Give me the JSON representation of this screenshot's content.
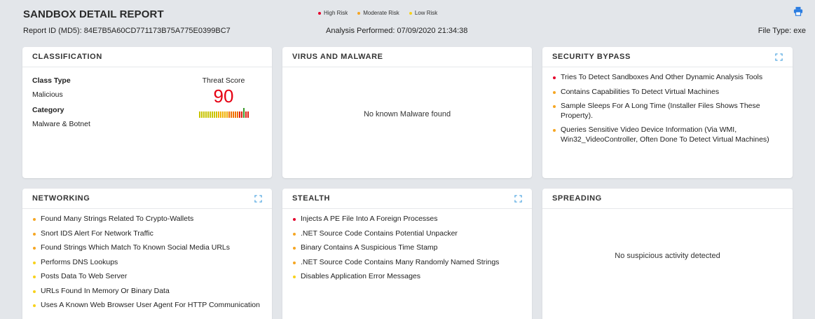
{
  "header": {
    "title": "SANDBOX DETAIL REPORT",
    "report_id": "Report ID (MD5): 84E7B5A60CD771173B75A775E0399BC7",
    "analysis": "Analysis Performed: 07/09/2020 21:34:38",
    "file_type": "File Type: exe"
  },
  "legend": [
    {
      "label": "High Risk",
      "color": "#e4002b"
    },
    {
      "label": "Moderate Risk",
      "color": "#f5a623"
    },
    {
      "label": "Low Risk",
      "color": "#f8d21c"
    }
  ],
  "icons": {
    "print": "print-icon",
    "expand": "expand-icon"
  },
  "colors": {
    "accent": "#2b7de1",
    "threat": "#e60012"
  },
  "classification": {
    "title": "CLASSIFICATION",
    "class_type_label": "Class Type",
    "class_type_value": "Malicious",
    "category_label": "Category",
    "category_value": "Malware & Botnet",
    "threat_label": "Threat Score",
    "threat_score": "90",
    "threat_level": 0.9
  },
  "virus": {
    "title": "VIRUS AND MALWARE",
    "message": "No known Malware found"
  },
  "security_bypass": {
    "title": "SECURITY BYPASS",
    "items": [
      {
        "text": "Tries To Detect Sandboxes And Other Dynamic Analysis Tools",
        "risk": "high"
      },
      {
        "text": "Contains Capabilities To Detect Virtual Machines",
        "risk": "moderate"
      },
      {
        "text": "Sample Sleeps For A Long Time (Installer Files Shows These Property).",
        "risk": "moderate"
      },
      {
        "text": "Queries Sensitive Video Device Information (Via WMI, Win32_VideoController, Often Done To Detect Virtual Machines)",
        "risk": "moderate"
      }
    ]
  },
  "networking": {
    "title": "NETWORKING",
    "items": [
      {
        "text": "Found Many Strings Related To Crypto-Wallets",
        "risk": "moderate"
      },
      {
        "text": "Snort IDS Alert For Network Traffic",
        "risk": "moderate"
      },
      {
        "text": "Found Strings Which Match To Known Social Media URLs",
        "risk": "moderate"
      },
      {
        "text": "Performs DNS Lookups",
        "risk": "low"
      },
      {
        "text": "Posts Data To Web Server",
        "risk": "low"
      },
      {
        "text": "URLs Found In Memory Or Binary Data",
        "risk": "low"
      },
      {
        "text": "Uses A Known Web Browser User Agent For HTTP Communication",
        "risk": "low"
      }
    ]
  },
  "stealth": {
    "title": "STEALTH",
    "items": [
      {
        "text": "Injects A PE File Into A Foreign Processes",
        "risk": "high"
      },
      {
        "text": ".NET Source Code Contains Potential Unpacker",
        "risk": "moderate"
      },
      {
        "text": "Binary Contains A Suspicious Time Stamp",
        "risk": "moderate"
      },
      {
        "text": ".NET Source Code Contains Many Randomly Named Strings",
        "risk": "moderate"
      },
      {
        "text": "Disables Application Error Messages",
        "risk": "low"
      }
    ]
  },
  "spreading": {
    "title": "SPREADING",
    "message": "No suspicious activity detected"
  }
}
